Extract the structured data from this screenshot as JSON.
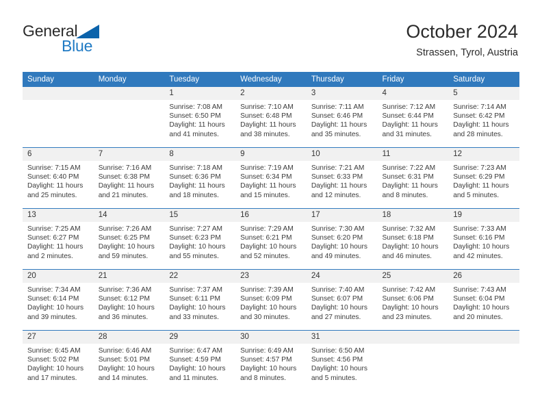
{
  "brand": {
    "name_part1": "General",
    "name_part2": "Blue",
    "triangle_color": "#0b63ab",
    "blue_color": "#1f7ac4"
  },
  "header": {
    "title": "October 2024",
    "location": "Strassen, Tyrol, Austria"
  },
  "theme": {
    "header_blue": "#3079bd",
    "daynum_bg": "#f1f1f1",
    "text": "#3a3a3a"
  },
  "weekday_headers": [
    "Sunday",
    "Monday",
    "Tuesday",
    "Wednesday",
    "Thursday",
    "Friday",
    "Saturday"
  ],
  "labels": {
    "sunrise_prefix": "Sunrise:",
    "sunset_prefix": "Sunset:",
    "daylight_prefix": "Daylight:"
  },
  "weeks": [
    [
      {
        "day": "",
        "blank": true,
        "sunrise": "",
        "sunset": "",
        "daylight_line1": "",
        "daylight_line2": ""
      },
      {
        "day": "",
        "blank": true,
        "sunrise": "",
        "sunset": "",
        "daylight_line1": "",
        "daylight_line2": ""
      },
      {
        "day": "1",
        "sunrise": "Sunrise: 7:08 AM",
        "sunset": "Sunset: 6:50 PM",
        "daylight_line1": "Daylight: 11 hours",
        "daylight_line2": "and 41 minutes."
      },
      {
        "day": "2",
        "sunrise": "Sunrise: 7:10 AM",
        "sunset": "Sunset: 6:48 PM",
        "daylight_line1": "Daylight: 11 hours",
        "daylight_line2": "and 38 minutes."
      },
      {
        "day": "3",
        "sunrise": "Sunrise: 7:11 AM",
        "sunset": "Sunset: 6:46 PM",
        "daylight_line1": "Daylight: 11 hours",
        "daylight_line2": "and 35 minutes."
      },
      {
        "day": "4",
        "sunrise": "Sunrise: 7:12 AM",
        "sunset": "Sunset: 6:44 PM",
        "daylight_line1": "Daylight: 11 hours",
        "daylight_line2": "and 31 minutes."
      },
      {
        "day": "5",
        "sunrise": "Sunrise: 7:14 AM",
        "sunset": "Sunset: 6:42 PM",
        "daylight_line1": "Daylight: 11 hours",
        "daylight_line2": "and 28 minutes."
      }
    ],
    [
      {
        "day": "6",
        "sunrise": "Sunrise: 7:15 AM",
        "sunset": "Sunset: 6:40 PM",
        "daylight_line1": "Daylight: 11 hours",
        "daylight_line2": "and 25 minutes."
      },
      {
        "day": "7",
        "sunrise": "Sunrise: 7:16 AM",
        "sunset": "Sunset: 6:38 PM",
        "daylight_line1": "Daylight: 11 hours",
        "daylight_line2": "and 21 minutes."
      },
      {
        "day": "8",
        "sunrise": "Sunrise: 7:18 AM",
        "sunset": "Sunset: 6:36 PM",
        "daylight_line1": "Daylight: 11 hours",
        "daylight_line2": "and 18 minutes."
      },
      {
        "day": "9",
        "sunrise": "Sunrise: 7:19 AM",
        "sunset": "Sunset: 6:34 PM",
        "daylight_line1": "Daylight: 11 hours",
        "daylight_line2": "and 15 minutes."
      },
      {
        "day": "10",
        "sunrise": "Sunrise: 7:21 AM",
        "sunset": "Sunset: 6:33 PM",
        "daylight_line1": "Daylight: 11 hours",
        "daylight_line2": "and 12 minutes."
      },
      {
        "day": "11",
        "sunrise": "Sunrise: 7:22 AM",
        "sunset": "Sunset: 6:31 PM",
        "daylight_line1": "Daylight: 11 hours",
        "daylight_line2": "and 8 minutes."
      },
      {
        "day": "12",
        "sunrise": "Sunrise: 7:23 AM",
        "sunset": "Sunset: 6:29 PM",
        "daylight_line1": "Daylight: 11 hours",
        "daylight_line2": "and 5 minutes."
      }
    ],
    [
      {
        "day": "13",
        "sunrise": "Sunrise: 7:25 AM",
        "sunset": "Sunset: 6:27 PM",
        "daylight_line1": "Daylight: 11 hours",
        "daylight_line2": "and 2 minutes."
      },
      {
        "day": "14",
        "sunrise": "Sunrise: 7:26 AM",
        "sunset": "Sunset: 6:25 PM",
        "daylight_line1": "Daylight: 10 hours",
        "daylight_line2": "and 59 minutes."
      },
      {
        "day": "15",
        "sunrise": "Sunrise: 7:27 AM",
        "sunset": "Sunset: 6:23 PM",
        "daylight_line1": "Daylight: 10 hours",
        "daylight_line2": "and 55 minutes."
      },
      {
        "day": "16",
        "sunrise": "Sunrise: 7:29 AM",
        "sunset": "Sunset: 6:21 PM",
        "daylight_line1": "Daylight: 10 hours",
        "daylight_line2": "and 52 minutes."
      },
      {
        "day": "17",
        "sunrise": "Sunrise: 7:30 AM",
        "sunset": "Sunset: 6:20 PM",
        "daylight_line1": "Daylight: 10 hours",
        "daylight_line2": "and 49 minutes."
      },
      {
        "day": "18",
        "sunrise": "Sunrise: 7:32 AM",
        "sunset": "Sunset: 6:18 PM",
        "daylight_line1": "Daylight: 10 hours",
        "daylight_line2": "and 46 minutes."
      },
      {
        "day": "19",
        "sunrise": "Sunrise: 7:33 AM",
        "sunset": "Sunset: 6:16 PM",
        "daylight_line1": "Daylight: 10 hours",
        "daylight_line2": "and 42 minutes."
      }
    ],
    [
      {
        "day": "20",
        "sunrise": "Sunrise: 7:34 AM",
        "sunset": "Sunset: 6:14 PM",
        "daylight_line1": "Daylight: 10 hours",
        "daylight_line2": "and 39 minutes."
      },
      {
        "day": "21",
        "sunrise": "Sunrise: 7:36 AM",
        "sunset": "Sunset: 6:12 PM",
        "daylight_line1": "Daylight: 10 hours",
        "daylight_line2": "and 36 minutes."
      },
      {
        "day": "22",
        "sunrise": "Sunrise: 7:37 AM",
        "sunset": "Sunset: 6:11 PM",
        "daylight_line1": "Daylight: 10 hours",
        "daylight_line2": "and 33 minutes."
      },
      {
        "day": "23",
        "sunrise": "Sunrise: 7:39 AM",
        "sunset": "Sunset: 6:09 PM",
        "daylight_line1": "Daylight: 10 hours",
        "daylight_line2": "and 30 minutes."
      },
      {
        "day": "24",
        "sunrise": "Sunrise: 7:40 AM",
        "sunset": "Sunset: 6:07 PM",
        "daylight_line1": "Daylight: 10 hours",
        "daylight_line2": "and 27 minutes."
      },
      {
        "day": "25",
        "sunrise": "Sunrise: 7:42 AM",
        "sunset": "Sunset: 6:06 PM",
        "daylight_line1": "Daylight: 10 hours",
        "daylight_line2": "and 23 minutes."
      },
      {
        "day": "26",
        "sunrise": "Sunrise: 7:43 AM",
        "sunset": "Sunset: 6:04 PM",
        "daylight_line1": "Daylight: 10 hours",
        "daylight_line2": "and 20 minutes."
      }
    ],
    [
      {
        "day": "27",
        "sunrise": "Sunrise: 6:45 AM",
        "sunset": "Sunset: 5:02 PM",
        "daylight_line1": "Daylight: 10 hours",
        "daylight_line2": "and 17 minutes."
      },
      {
        "day": "28",
        "sunrise": "Sunrise: 6:46 AM",
        "sunset": "Sunset: 5:01 PM",
        "daylight_line1": "Daylight: 10 hours",
        "daylight_line2": "and 14 minutes."
      },
      {
        "day": "29",
        "sunrise": "Sunrise: 6:47 AM",
        "sunset": "Sunset: 4:59 PM",
        "daylight_line1": "Daylight: 10 hours",
        "daylight_line2": "and 11 minutes."
      },
      {
        "day": "30",
        "sunrise": "Sunrise: 6:49 AM",
        "sunset": "Sunset: 4:57 PM",
        "daylight_line1": "Daylight: 10 hours",
        "daylight_line2": "and 8 minutes."
      },
      {
        "day": "31",
        "sunrise": "Sunrise: 6:50 AM",
        "sunset": "Sunset: 4:56 PM",
        "daylight_line1": "Daylight: 10 hours",
        "daylight_line2": "and 5 minutes."
      },
      {
        "day": "",
        "blank": true,
        "sunrise": "",
        "sunset": "",
        "daylight_line1": "",
        "daylight_line2": ""
      },
      {
        "day": "",
        "blank": true,
        "sunrise": "",
        "sunset": "",
        "daylight_line1": "",
        "daylight_line2": ""
      }
    ]
  ]
}
